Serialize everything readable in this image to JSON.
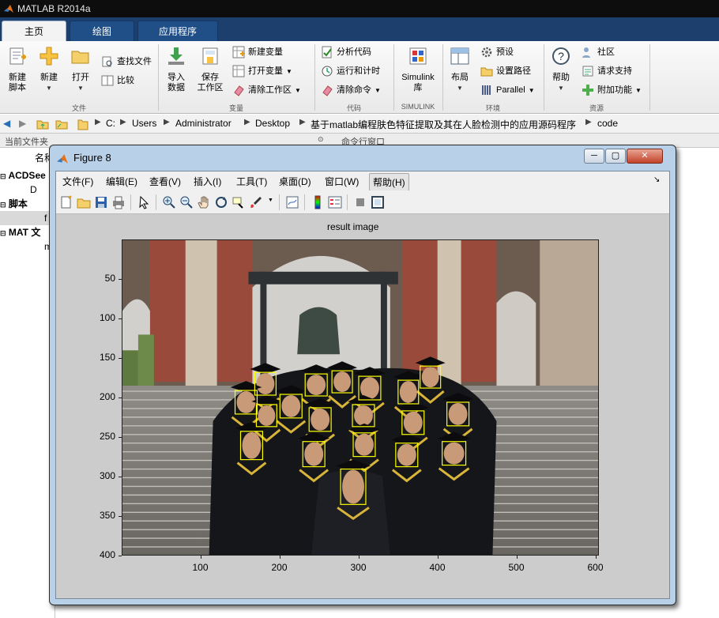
{
  "app": {
    "title": "MATLAB R2014a"
  },
  "tabs": [
    {
      "label": "主页",
      "active": true
    },
    {
      "label": "绘图",
      "active": false
    },
    {
      "label": "应用程序",
      "active": false
    }
  ],
  "ribbon": {
    "file": {
      "group_label": "文件",
      "new_script": "新建\n脚本",
      "new": "新建",
      "open": "打开",
      "find_files": "查找文件",
      "compare": "比较"
    },
    "variable": {
      "group_label": "变量",
      "import": "导入\n数据",
      "save_ws": "保存\n工作区",
      "new_var": "新建变量",
      "open_var": "打开变量",
      "clear_ws": "清除工作区"
    },
    "code": {
      "group_label": "代码",
      "analyze": "分析代码",
      "run_time": "运行和计时",
      "clear_cmd": "清除命令"
    },
    "simulink": {
      "group_label": "SIMULINK",
      "label": "Simulink\n库"
    },
    "env": {
      "group_label": "环境",
      "layout": "布局",
      "prefs": "预设",
      "set_path": "设置路径",
      "parallel": "Parallel"
    },
    "resources": {
      "group_label": "资源",
      "help": "帮助",
      "community": "社区",
      "support": "请求支持",
      "addons": "附加功能"
    }
  },
  "address": {
    "segments": [
      "C:",
      "Users",
      "Administrator",
      "Desktop",
      "基于matlab编程肤色特征提取及其在人脸检测中的应用源码程序",
      "code"
    ]
  },
  "panels": {
    "current_folder": "当前文件夹",
    "command_window": "命令行窗口",
    "name_col": "名称"
  },
  "left_tree": [
    {
      "label": "ACDSee",
      "header": true
    },
    {
      "label": "D",
      "header": false
    },
    {
      "label": "脚本",
      "header": true
    },
    {
      "label": "f",
      "header": false
    },
    {
      "label": "MAT 文",
      "header": true
    },
    {
      "label": "m",
      "header": false
    }
  ],
  "figure": {
    "title": "Figure 8",
    "menus": [
      "文件(F)",
      "编辑(E)",
      "查看(V)",
      "插入(I)",
      "工具(T)",
      "桌面(D)",
      "窗口(W)",
      "帮助(H)"
    ],
    "axes_title": "result image",
    "yticks": [
      "50",
      "100",
      "150",
      "200",
      "250",
      "300",
      "350",
      "400"
    ],
    "xticks": [
      "100",
      "200",
      "300",
      "400",
      "500",
      "600"
    ]
  },
  "chart_data": {
    "type": "image",
    "title": "result image",
    "xlim": [
      0.5,
      604.5
    ],
    "ylim": [
      0.5,
      400.5
    ],
    "y_reversed": true,
    "x_ticks": [
      100,
      200,
      300,
      400,
      500,
      600
    ],
    "y_ticks": [
      50,
      100,
      150,
      200,
      250,
      300,
      350,
      400
    ],
    "face_box_color": "#ffff00",
    "face_boxes": [
      [
        168,
        168,
        27,
        29
      ],
      [
        232,
        170,
        28,
        28
      ],
      [
        266,
        166,
        26,
        28
      ],
      [
        300,
        173,
        28,
        30
      ],
      [
        350,
        178,
        26,
        30
      ],
      [
        378,
        160,
        26,
        28
      ],
      [
        143,
        191,
        28,
        30
      ],
      [
        170,
        209,
        26,
        28
      ],
      [
        200,
        196,
        28,
        30
      ],
      [
        237,
        213,
        28,
        30
      ],
      [
        292,
        209,
        28,
        28
      ],
      [
        355,
        217,
        28,
        30
      ],
      [
        412,
        206,
        28,
        30
      ],
      [
        150,
        243,
        28,
        36
      ],
      [
        229,
        256,
        28,
        32
      ],
      [
        293,
        245,
        28,
        30
      ],
      [
        347,
        258,
        28,
        30
      ],
      [
        406,
        256,
        30,
        30
      ],
      [
        277,
        291,
        32,
        45
      ]
    ]
  }
}
